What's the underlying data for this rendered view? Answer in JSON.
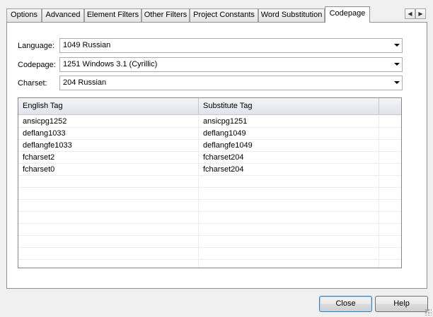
{
  "tabs": [
    {
      "label": "Options"
    },
    {
      "label": "Advanced"
    },
    {
      "label": "Element Filters"
    },
    {
      "label": "Other Filters"
    },
    {
      "label": "Project Constants"
    },
    {
      "label": "Word Substitution"
    },
    {
      "label": "Codepage"
    }
  ],
  "active_tab": "Codepage",
  "tab_scroll": {
    "left_icon": "triangle-left-icon",
    "right_icon": "triangle-right-icon"
  },
  "fields": {
    "language": {
      "label": "Language:",
      "value": "1049 Russian"
    },
    "codepage": {
      "label": "Codepage:",
      "value": "1251 Windows 3.1 (Cyrillic)"
    },
    "charset": {
      "label": "Charset:",
      "value": "204 Russian"
    }
  },
  "grid": {
    "columns": [
      "English Tag",
      "Substitute Tag"
    ],
    "rows": [
      [
        "ansicpg1252",
        "ansicpg1251"
      ],
      [
        "deflang1033",
        "deflang1049"
      ],
      [
        "deflangfe1033",
        "deflangfe1049"
      ],
      [
        "fcharset2",
        "fcharset204"
      ],
      [
        "fcharset0",
        "fcharset204"
      ]
    ]
  },
  "buttons": {
    "close": "Close",
    "help": "Help"
  }
}
